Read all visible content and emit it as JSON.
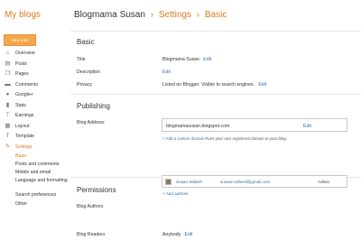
{
  "header": {
    "brand": "My blogs",
    "blog_name": "Blogmama Susan",
    "separator": "›",
    "crumbs": [
      "Settings",
      "Basic"
    ]
  },
  "new_post_label": "New post",
  "sidebar": {
    "items": [
      {
        "label": "Overview",
        "icon": "home-icon"
      },
      {
        "label": "Posts",
        "icon": "posts-icon"
      },
      {
        "label": "Pages",
        "icon": "pages-icon"
      },
      {
        "label": "Comments",
        "icon": "comments-icon"
      },
      {
        "label": "Google+",
        "icon": "google-plus-icon"
      },
      {
        "label": "Stats",
        "icon": "stats-icon"
      },
      {
        "label": "Earnings",
        "icon": "earnings-icon"
      },
      {
        "label": "Layout",
        "icon": "layout-icon"
      },
      {
        "label": "Template",
        "icon": "template-icon"
      },
      {
        "label": "Settings",
        "icon": "wrench-icon",
        "active": true
      }
    ],
    "sub_items": [
      {
        "label": "Basic",
        "active": true
      },
      {
        "label": "Posts and comments"
      },
      {
        "label": "Mobile and email"
      },
      {
        "label": "Language and formatting"
      },
      {
        "label": "Search preferences"
      },
      {
        "label": "Other"
      }
    ]
  },
  "basic": {
    "title": "Basic",
    "rows": {
      "title_label": "Title",
      "title_value": "Blogmama Susan",
      "title_edit": "Edit",
      "description_label": "Description",
      "description_edit": "Edit",
      "privacy_label": "Privacy",
      "privacy_value": "Listed on Blogger. Visible to search engines.",
      "privacy_edit": "Edit"
    }
  },
  "publishing": {
    "title": "Publishing",
    "address_label": "Blog Address",
    "address_value": "blogmamasusan.blogspot.com",
    "address_edit": "Edit",
    "custom_domain_link": "+ Add a custom domain",
    "custom_domain_note": "Point your own registered domain to your blog."
  },
  "permissions": {
    "title": "Permissions",
    "authors_label": "Blog Authors",
    "author_name": "Susan Stilwell",
    "author_email": "susann.stilwell@gmail.com",
    "author_role": "Admin",
    "add_authors": "+ Add authors",
    "readers_label": "Blog Readers",
    "readers_value": "Anybody",
    "readers_edit": "Edit"
  },
  "colors": {
    "accent": "#dd7a1f",
    "link": "#3b6ea5",
    "new_post_button": "#f4a64a"
  }
}
